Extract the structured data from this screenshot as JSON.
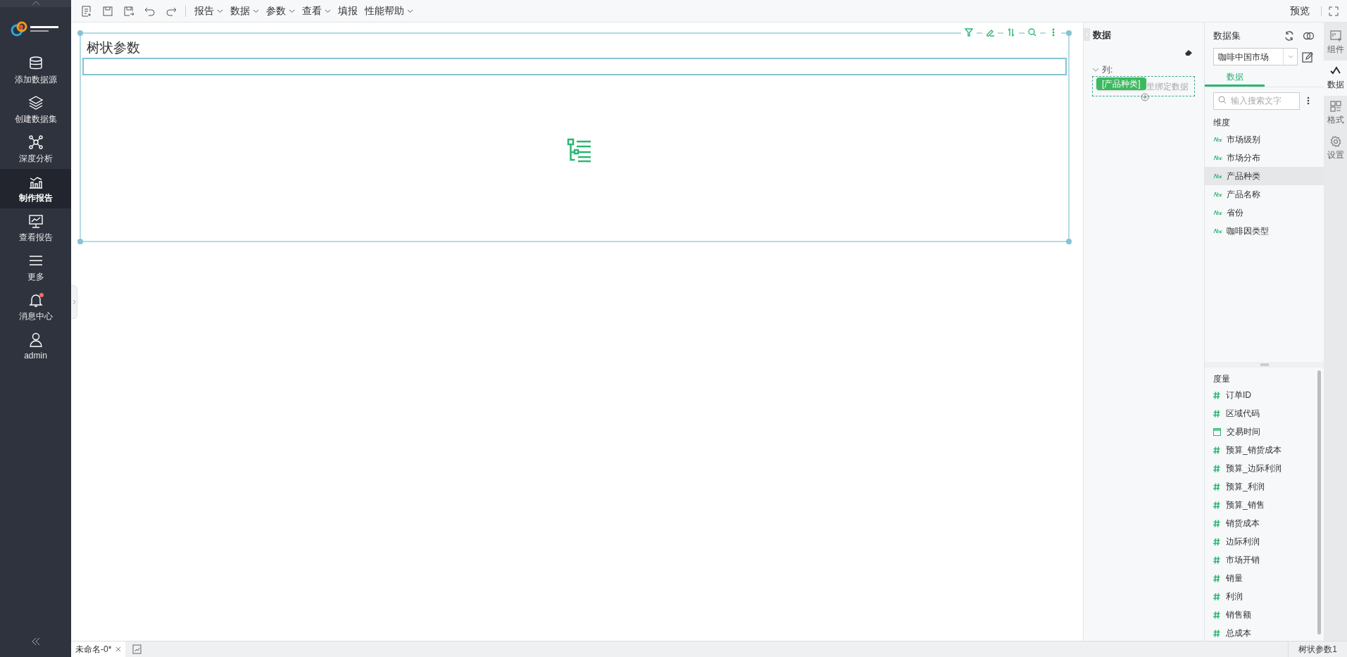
{
  "sidebar": {
    "items": [
      {
        "label": "添加数据源",
        "selected": false,
        "unread": false
      },
      {
        "label": "创建数据集",
        "selected": false,
        "unread": false
      },
      {
        "label": "深度分析",
        "selected": false,
        "unread": false
      },
      {
        "label": "制作报告",
        "selected": true,
        "unread": false
      },
      {
        "label": "查看报告",
        "selected": false,
        "unread": false
      },
      {
        "label": "更多",
        "selected": false,
        "unread": false
      },
      {
        "label": "消息中心",
        "selected": false,
        "unread": true
      },
      {
        "label": "admin",
        "selected": false,
        "unread": false
      }
    ]
  },
  "toolbar": {
    "menus": [
      {
        "label": "报告",
        "dropdown": true
      },
      {
        "label": "数据",
        "dropdown": true
      },
      {
        "label": "参数",
        "dropdown": true
      },
      {
        "label": "查看",
        "dropdown": true
      },
      {
        "label": "填报",
        "dropdown": false
      },
      {
        "label": "性能帮助",
        "dropdown": true
      }
    ],
    "preview": "预览"
  },
  "widget": {
    "title": "树状参数"
  },
  "binding_panel": {
    "title": "数据",
    "section": "列:",
    "expanded": true,
    "drag_chip": "[产品种类]",
    "placeholder": "里绑定数据"
  },
  "dataset_panel": {
    "title": "数据集",
    "dataset": "咖啡中国市场",
    "tabs": [
      {
        "label": "数据",
        "selected": true
      }
    ],
    "search_placeholder": "输入搜索文字",
    "dimensions": {
      "title": "维度",
      "items": [
        {
          "label": "市场级别",
          "selected": false
        },
        {
          "label": "市场分布",
          "selected": false
        },
        {
          "label": "产品种类",
          "selected": true
        },
        {
          "label": "产品名称",
          "selected": false
        },
        {
          "label": "省份",
          "selected": false
        },
        {
          "label": "咖啡因类型",
          "selected": false
        }
      ]
    },
    "measures": {
      "title": "度量",
      "items": [
        {
          "label": "订单ID",
          "kind": "number"
        },
        {
          "label": "区域代码",
          "kind": "number"
        },
        {
          "label": "交易时间",
          "kind": "date"
        },
        {
          "label": "预算_销货成本",
          "kind": "number"
        },
        {
          "label": "预算_边际利润",
          "kind": "number"
        },
        {
          "label": "预算_利润",
          "kind": "number"
        },
        {
          "label": "预算_销售",
          "kind": "number"
        },
        {
          "label": "销货成本",
          "kind": "number"
        },
        {
          "label": "边际利润",
          "kind": "number"
        },
        {
          "label": "市场开销",
          "kind": "number"
        },
        {
          "label": "销量",
          "kind": "number"
        },
        {
          "label": "利润",
          "kind": "number"
        },
        {
          "label": "销售额",
          "kind": "number"
        },
        {
          "label": "总成本",
          "kind": "number"
        }
      ]
    }
  },
  "right_tabs": [
    {
      "label": "组件",
      "selected": false
    },
    {
      "label": "数据",
      "selected": true
    },
    {
      "label": "格式",
      "selected": false
    },
    {
      "label": "设置",
      "selected": false
    }
  ],
  "bottom_bar": {
    "tabs": [
      {
        "label": "未命名-0*",
        "selected": true
      }
    ],
    "status": "树状参数1"
  }
}
